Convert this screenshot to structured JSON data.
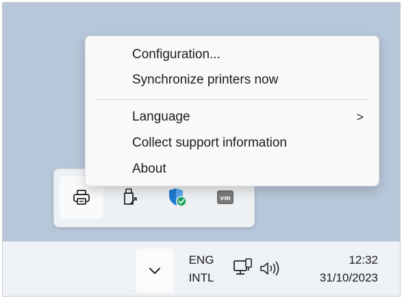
{
  "context_menu": {
    "items": [
      {
        "label": "Configuration...",
        "has_submenu": false
      },
      {
        "label": "Synchronize printers now",
        "has_submenu": false
      },
      {
        "label": "Language",
        "has_submenu": true
      },
      {
        "label": "Collect support information",
        "has_submenu": false
      },
      {
        "label": "About",
        "has_submenu": false
      }
    ],
    "submenu_glyph": ">"
  },
  "overflow_tray": {
    "icons": [
      {
        "name": "printer-icon",
        "selected": true
      },
      {
        "name": "usb-drive-icon",
        "selected": false
      },
      {
        "name": "security-shield-icon",
        "selected": false
      },
      {
        "name": "vm-icon",
        "selected": false
      }
    ],
    "vm_label": "vm"
  },
  "taskbar": {
    "language": {
      "line1": "ENG",
      "line2": "INTL"
    },
    "clock": {
      "time": "12:32",
      "date": "31/10/2023"
    },
    "icons": [
      "chevron-down-icon",
      "network-icon",
      "volume-icon"
    ]
  },
  "colors": {
    "desktop": "#b6c7d9",
    "taskbar": "#eef1f5",
    "menu": "#f9f9f9",
    "shield_blue": "#1f7ad1",
    "check_green": "#1aa35b"
  }
}
